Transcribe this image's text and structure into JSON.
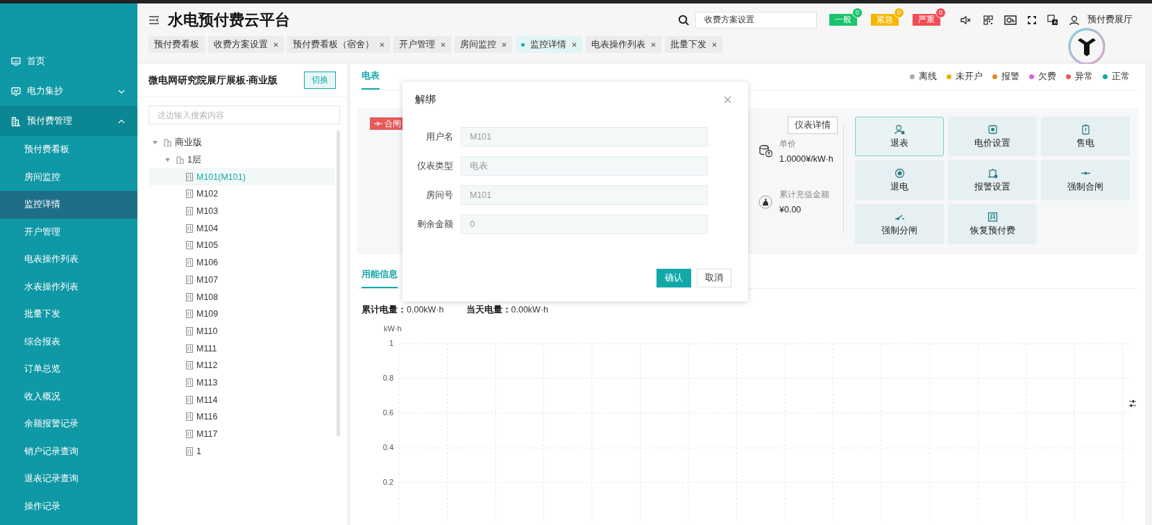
{
  "header": {
    "title": "水电预付费云平台",
    "search_value": "收费方案设置",
    "user": "预付费展厅",
    "alerts": [
      {
        "label": "一般",
        "count": "0",
        "color": "#19c36b"
      },
      {
        "label": "紧急",
        "count": "0",
        "color": "#f7b500"
      },
      {
        "label": "严重",
        "count": "0",
        "color": "#f24d56"
      }
    ]
  },
  "tabs": [
    {
      "label": "预付费看板",
      "closable": false,
      "selected": false
    },
    {
      "label": "收费方案设置",
      "closable": true,
      "selected": false
    },
    {
      "label": "预付费看板（宿舍）",
      "closable": true,
      "selected": false
    },
    {
      "label": "开户管理",
      "closable": true,
      "selected": false
    },
    {
      "label": "房间监控",
      "closable": true,
      "selected": false
    },
    {
      "label": "监控详情",
      "closable": true,
      "selected": true
    },
    {
      "label": "电表操作列表",
      "closable": true,
      "selected": false
    },
    {
      "label": "批量下发",
      "closable": true,
      "selected": false
    }
  ],
  "sidebar": {
    "items": [
      {
        "label": "首页",
        "kind": "link",
        "selected": false
      },
      {
        "label": "电力集抄",
        "kind": "group",
        "expanded": false
      },
      {
        "label": "预付费管理",
        "kind": "group",
        "expanded": true,
        "children": [
          {
            "label": "预付费看板",
            "selected": false
          },
          {
            "label": "房间监控",
            "selected": false
          },
          {
            "label": "监控详情",
            "selected": true
          },
          {
            "label": "开户管理",
            "selected": false
          },
          {
            "label": "电表操作列表",
            "selected": false
          },
          {
            "label": "水表操作列表",
            "selected": false
          },
          {
            "label": "批量下发",
            "selected": false
          },
          {
            "label": "综合报表",
            "selected": false
          },
          {
            "label": "订单总览",
            "selected": false
          },
          {
            "label": "收入概况",
            "selected": false
          },
          {
            "label": "余额报警记录",
            "selected": false
          },
          {
            "label": "销户记录查询",
            "selected": false
          },
          {
            "label": "退表记录查询",
            "selected": false
          },
          {
            "label": "操作记录",
            "selected": false
          }
        ]
      }
    ]
  },
  "tree_panel": {
    "title": "微电网研究院展厅展板-商业版",
    "switch_button": "切换",
    "search_placeholder": "这边输入搜索内容",
    "nodes": [
      {
        "label": "商业版",
        "kind": "folder",
        "expanded": true,
        "selected": false,
        "children": [
          {
            "label": "1层",
            "kind": "folder",
            "expanded": true,
            "selected": false,
            "children": [
              {
                "label": "M101(M101)",
                "kind": "meter",
                "selected": true
              },
              {
                "label": "M102",
                "kind": "meter",
                "selected": false
              },
              {
                "label": "M103",
                "kind": "meter",
                "selected": false
              },
              {
                "label": "M104",
                "kind": "meter",
                "selected": false
              },
              {
                "label": "M105",
                "kind": "meter",
                "selected": false
              },
              {
                "label": "M106",
                "kind": "meter",
                "selected": false
              },
              {
                "label": "M107",
                "kind": "meter",
                "selected": false
              },
              {
                "label": "M108",
                "kind": "meter",
                "selected": false
              },
              {
                "label": "M109",
                "kind": "meter",
                "selected": false
              },
              {
                "label": "M110",
                "kind": "meter",
                "selected": false
              },
              {
                "label": "M111",
                "kind": "meter",
                "selected": false
              },
              {
                "label": "M112",
                "kind": "meter",
                "selected": false
              },
              {
                "label": "M113",
                "kind": "meter",
                "selected": false
              },
              {
                "label": "M114",
                "kind": "meter",
                "selected": false
              },
              {
                "label": "M116",
                "kind": "meter",
                "selected": false
              },
              {
                "label": "M117",
                "kind": "meter",
                "selected": false
              },
              {
                "label": "1",
                "kind": "meter",
                "selected": false
              }
            ]
          }
        ]
      }
    ]
  },
  "main": {
    "tab": {
      "label": "电表",
      "selected": true
    },
    "legend": [
      {
        "label": "离线",
        "color": "#aaaaaa"
      },
      {
        "label": "未开户",
        "color": "#e0b800"
      },
      {
        "label": "报警",
        "color": "#e8862a"
      },
      {
        "label": "欠费",
        "color": "#e05ce0"
      },
      {
        "label": "异常",
        "color": "#ef5a5a"
      },
      {
        "label": "正常",
        "color": "#13a8a8"
      }
    ],
    "meter_card": {
      "status_tag": "合闸",
      "details_button": "仪表详情",
      "stats": [
        {
          "label": "单价",
          "value": "1.0000¥/kW·h"
        },
        {
          "label": "累计充值金额",
          "value": "¥0.00"
        }
      ]
    },
    "actions": [
      {
        "label": "退表",
        "selected": true
      },
      {
        "label": "电价设置",
        "selected": false
      },
      {
        "label": "售电",
        "selected": false
      },
      {
        "label": "退电",
        "selected": false
      },
      {
        "label": "报警设置",
        "selected": false
      },
      {
        "label": "强制合闸",
        "selected": false
      },
      {
        "label": "强制分闸",
        "selected": false
      },
      {
        "label": "恢复预付费",
        "selected": false
      }
    ],
    "usage_tab": {
      "label": "用能信息",
      "selected": true
    },
    "usage_stats": [
      {
        "label": "累计电量：",
        "value": "0.00kW·h"
      },
      {
        "label": "当天电量：",
        "value": "0.00kW·h"
      }
    ],
    "usage_grid": {
      "unit": "kW·h",
      "ticks": [
        "1",
        "0.8",
        "0.6",
        "0.4",
        "0.2"
      ]
    }
  },
  "dialog": {
    "title": "解绑",
    "fields": [
      {
        "label": "用户名",
        "value": "M101"
      },
      {
        "label": "仪表类型",
        "value": "电表"
      },
      {
        "label": "房间号",
        "value": "M101"
      },
      {
        "label": "剩余金额",
        "value": "0"
      }
    ],
    "buttons": [
      {
        "label": "确认",
        "kind": "primary"
      },
      {
        "label": "取消",
        "kind": "default"
      }
    ]
  }
}
